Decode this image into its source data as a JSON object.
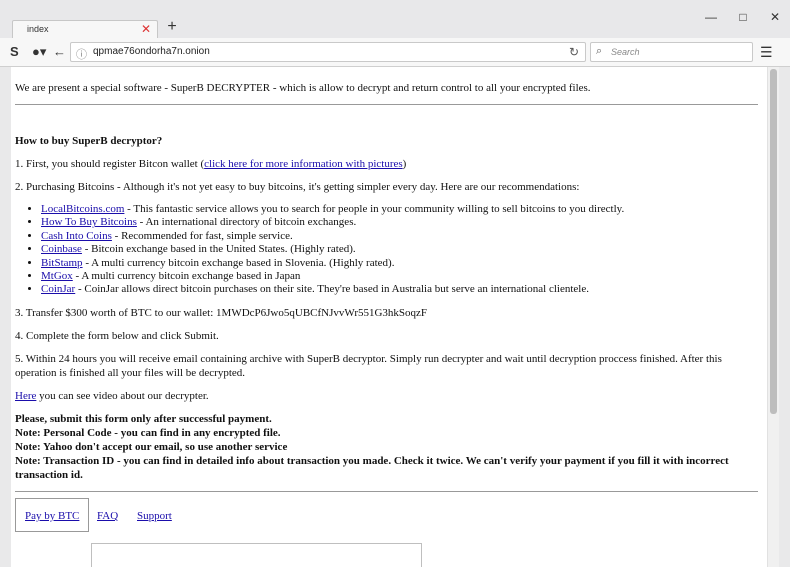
{
  "browser": {
    "tab_title": "index",
    "tab_close": "✕",
    "new_tab": "+",
    "address": "qpmae76ondorha7n.onion",
    "search_placeholder": "Search"
  },
  "page": {
    "intro": "We are present a special software - SuperB DECRYPTER - which is allow to decrypt and return control to all your encrypted files.",
    "how_heading": "How to buy SuperB decryptor?",
    "step1_prefix": "1. First, you should register Bitcon wallet (",
    "step1_link": "click here for more information with pictures",
    "step1_suffix": ")",
    "step2": "2. Purchasing Bitcoins - Although it's not yet easy to buy bitcoins, it's getting simpler every day. Here are our recommendations:",
    "exchanges": [
      {
        "name": "LocalBitcoins.com",
        "desc": " - This fantastic service allows you to search for people in your community willing to sell bitcoins to you directly."
      },
      {
        "name": "How To Buy Bitcoins",
        "desc": " - An international directory of bitcoin exchanges."
      },
      {
        "name": "Cash Into Coins",
        "desc": " - Recommended for fast, simple service."
      },
      {
        "name": "Coinbase",
        "desc": " - Bitcoin exchange based in the United States. (Highly rated)."
      },
      {
        "name": "BitStamp",
        "desc": " - A multi currency bitcoin exchange based in Slovenia. (Highly rated)."
      },
      {
        "name": "MtGox",
        "desc": " - A multi currency bitcoin exchange based in Japan"
      },
      {
        "name": "CoinJar",
        "desc": " - CoinJar allows direct bitcoin purchases on their site. They're based in Australia but serve an international clientele."
      }
    ],
    "step3": "3. Transfer $300 worth of BTC to our wallet: 1MWDcP6Jwo5qUBCfNJvvWr551G3hkSoqzF",
    "step4": "4. Complete the form below and click Submit.",
    "step5": "5. Within 24 hours you will receive email containing archive with SuperB decryptor. Simply run decrypter and wait until decryption proccess finished. After this operation is finished all your files will be decrypted.",
    "video_link": "Here",
    "video_text": " you can see video about our decrypter.",
    "notes": [
      "Please, submit this form only after successful payment.",
      "Note: Personal Code - you can find in any encrypted file.",
      "Note: Yahoo don't accept our email, so use another service",
      "Note: Transaction ID - you can find in detailed info about transaction you made. Check it twice. We can't verify your payment if you fill it with incorrect transaction id."
    ],
    "nav": {
      "pay": "Pay by BTC",
      "faq": "FAQ",
      "support": "Support"
    }
  }
}
